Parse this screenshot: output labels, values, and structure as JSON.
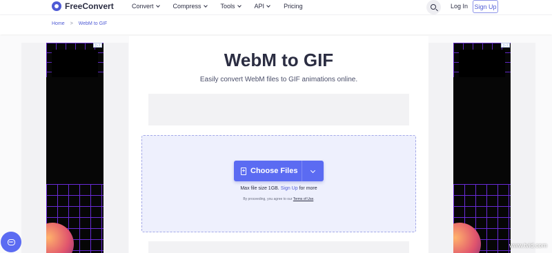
{
  "header": {
    "logo_text": "FreeConvert",
    "nav": [
      {
        "label": "Convert",
        "has_dropdown": true
      },
      {
        "label": "Compress",
        "has_dropdown": true
      },
      {
        "label": "Tools",
        "has_dropdown": true
      },
      {
        "label": "API",
        "has_dropdown": true
      },
      {
        "label": "Pricing",
        "has_dropdown": false
      }
    ],
    "search_icon": "search-icon",
    "login_label": "Log In",
    "signup_label": "Sign Up"
  },
  "breadcrumb": {
    "home": "Home",
    "separator": ">",
    "current": "WebM to GIF"
  },
  "main": {
    "title": "WebM to GIF",
    "subtitle": "Easily convert WebM files to GIF animations online.",
    "choose_files_label": "Choose Files",
    "max_size_prefix": "Max file size 1GB.",
    "max_size_link": "Sign Up",
    "max_size_suffix": "for more",
    "terms_prefix": "By proceeding, you agree to our",
    "terms_link": "Terms of Use",
    "terms_suffix": "."
  },
  "ads": {
    "badge_text": "▷ i"
  },
  "chat_icon": "chat-icon",
  "watermark": "www.tvid.com",
  "colors": {
    "accent": "#5b6bf2",
    "link": "#4f5bd5",
    "dropzone_bg": "#eef0fd"
  }
}
